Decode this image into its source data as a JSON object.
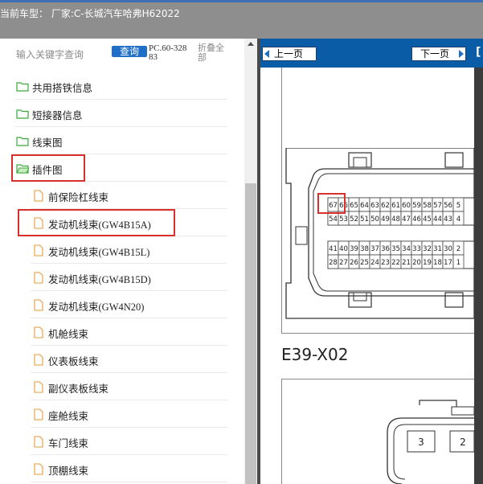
{
  "titlebar": {
    "label": "当前车型： 厂家:C-长城汽车哈弗H62022"
  },
  "left_panel": {
    "search": {
      "placeholder": "输入关键字查询",
      "button_label": "查询"
    },
    "code": "PC.60-32883",
    "collapse_all": "折叠全部",
    "folders": [
      {
        "label": "共用搭铁信息"
      },
      {
        "label": "短接器信息"
      },
      {
        "label": "线束图"
      },
      {
        "label": "插件图",
        "expanded": true,
        "highlighted": true
      }
    ],
    "children": [
      {
        "label": "前保险杠线束"
      },
      {
        "label": "发动机线束(GW4B15A)",
        "highlighted": true
      },
      {
        "label": "发动机线束(GW4B15L)"
      },
      {
        "label": "发动机线束(GW4B15D)"
      },
      {
        "label": "发动机线束(GW4N20)"
      },
      {
        "label": "机舱线束"
      },
      {
        "label": "仪表板线束"
      },
      {
        "label": "副仪表板线束"
      },
      {
        "label": "座舱线束"
      },
      {
        "label": "车门线束"
      },
      {
        "label": "顶棚线束"
      }
    ]
  },
  "doc_panel": {
    "prev_label": "上一页",
    "next_label": "下一页",
    "edge_fragment": "[",
    "connector_upper_row1": [
      "67",
      "66",
      "65",
      "64",
      "63",
      "62",
      "61",
      "60",
      "59",
      "58",
      "57",
      "56",
      "5"
    ],
    "connector_upper_row2": [
      "54",
      "53",
      "52",
      "51",
      "50",
      "49",
      "48",
      "47",
      "46",
      "45",
      "44",
      "43",
      "4"
    ],
    "connector_lower_row1": [
      "41",
      "40",
      "39",
      "38",
      "37",
      "36",
      "35",
      "34",
      "33",
      "32",
      "31",
      "30",
      "2"
    ],
    "connector_lower_row2": [
      "28",
      "27",
      "26",
      "25",
      "24",
      "23",
      "22",
      "21",
      "20",
      "19",
      "18",
      "17",
      "1"
    ],
    "connector_title": "E39-X02",
    "second_connector_pins": [
      "3",
      "2"
    ]
  },
  "colors": {
    "accent_blue": "#1f6fc8",
    "nav_bar": "#0a5ca6",
    "highlight_red": "#d9302c",
    "folder_green": "#3aa63a",
    "file_orange": "#e79a3c"
  }
}
